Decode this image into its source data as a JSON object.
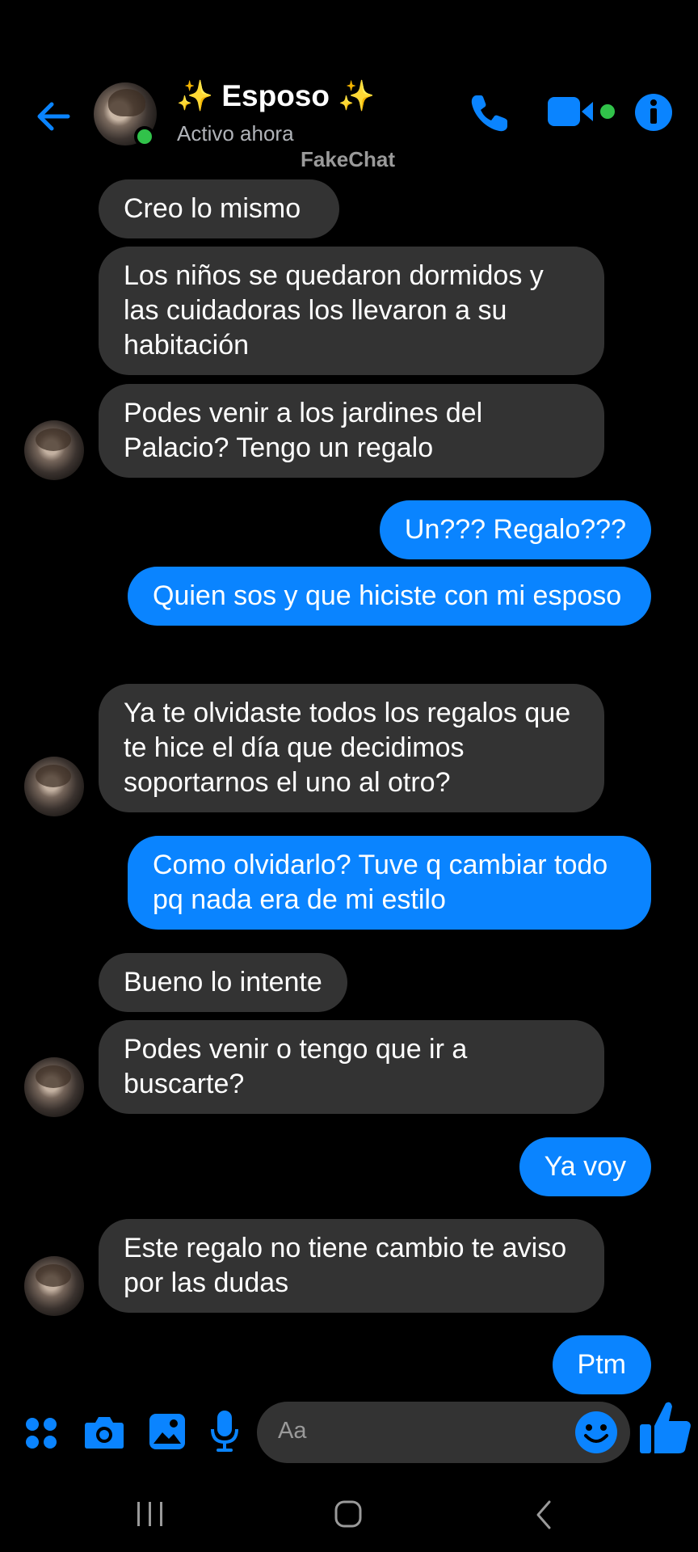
{
  "header": {
    "contact_name": "✨ Esposo ✨",
    "status": "Activo ahora",
    "watermark": "FakeChat",
    "icons": [
      "back-arrow-icon",
      "phone-icon",
      "video-camera-icon",
      "info-icon"
    ]
  },
  "messages": [
    {
      "side": "in",
      "text": "Creo lo mismo"
    },
    {
      "side": "in",
      "text": "Los niños se quedaron dormidos y las cuidadoras los llevaron a su habitación"
    },
    {
      "side": "in",
      "text": "Podes venir a los jardines del Palacio? Tengo un regalo"
    },
    {
      "side": "out",
      "text": "Un??? Regalo???"
    },
    {
      "side": "out",
      "text": "Quien sos y que hiciste con mi esposo"
    },
    {
      "side": "in",
      "text": "Ya te olvidaste todos los regalos que te hice el día que decidimos soportarnos el uno al otro?"
    },
    {
      "side": "out",
      "text": "Como olvidarlo? Tuve q cambiar todo pq nada era de mi estilo"
    },
    {
      "side": "in",
      "text": "Bueno lo intente"
    },
    {
      "side": "in",
      "text": "Podes venir o tengo que ir a buscarte?"
    },
    {
      "side": "out",
      "text": "Ya voy"
    },
    {
      "side": "in",
      "text": "Este regalo no tiene cambio te aviso por las dudas"
    },
    {
      "side": "out",
      "text": "Ptm"
    }
  ],
  "composer": {
    "placeholder": "Aa",
    "icons": [
      "apps-icon",
      "camera-icon",
      "gallery-icon",
      "microphone-icon",
      "emoji-icon",
      "thumbs-up-icon"
    ]
  },
  "navbar": {
    "icons": [
      "recent-apps-icon",
      "home-icon",
      "back-icon"
    ]
  },
  "colors": {
    "accent": "#0a84ff",
    "incoming_bubble": "#333333",
    "background": "#000000",
    "online": "#31c24a"
  }
}
